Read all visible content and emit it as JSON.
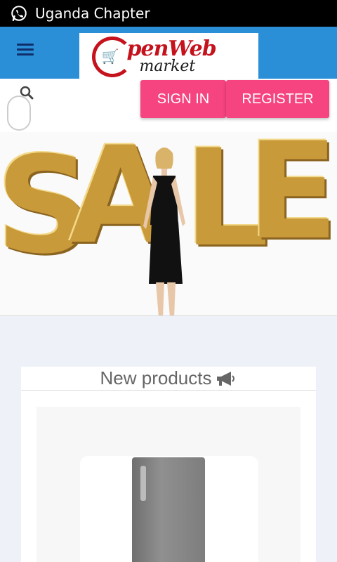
{
  "status_bar": {
    "icon": "whatsapp-icon",
    "title": "Uganda Chapter"
  },
  "header": {
    "menu_icon": "hamburger-menu-icon",
    "logo": {
      "main": "penWeb",
      "sub": "market"
    },
    "accent": "#2b8fd8"
  },
  "toolbar": {
    "search_icon": "search-icon",
    "sign_in": "SIGN IN",
    "register": "REGISTER",
    "button_color": "#f5447f"
  },
  "hero": {
    "banner_text": "SALE"
  },
  "products": {
    "title": "New products",
    "title_icon": "megaphone-icon"
  }
}
